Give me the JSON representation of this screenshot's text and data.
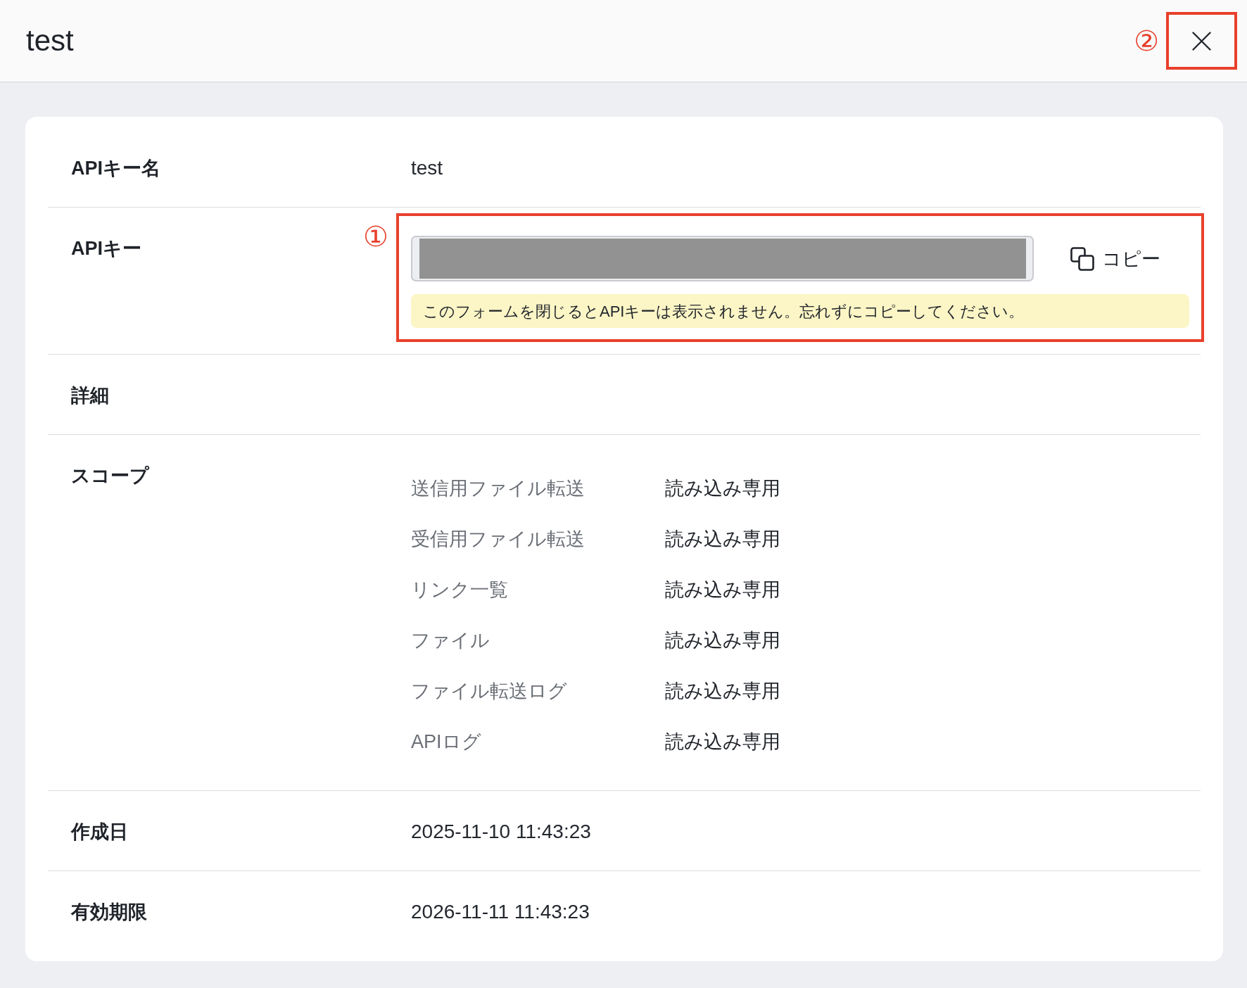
{
  "header": {
    "title": "test",
    "close_button": {
      "annotation": "②"
    }
  },
  "rows": [
    {
      "kind": "text",
      "label": "APIキー名",
      "value": "test"
    },
    {
      "kind": "api_key",
      "label": "APIキー",
      "copy_label": "コピー",
      "notice": "このフォームを閉じるとAPIキーは表示されません。忘れずにコピーしてください。",
      "annotation": "①"
    },
    {
      "kind": "heading",
      "label": "詳細"
    },
    {
      "kind": "scopes",
      "label": "スコープ",
      "scopes": [
        {
          "name": "送信用ファイル転送",
          "access": "読み込み専用"
        },
        {
          "name": "受信用ファイル転送",
          "access": "読み込み専用"
        },
        {
          "name": "リンク一覧",
          "access": "読み込み専用"
        },
        {
          "name": "ファイル",
          "access": "読み込み専用"
        },
        {
          "name": "ファイル転送ログ",
          "access": "読み込み専用"
        },
        {
          "name": "APIログ",
          "access": "読み込み専用"
        }
      ]
    },
    {
      "kind": "text",
      "label": "作成日",
      "value": "2025-11-10 11:43:23"
    },
    {
      "kind": "text",
      "label": "有効期限",
      "value": "2026-11-11 11:43:23"
    }
  ]
}
